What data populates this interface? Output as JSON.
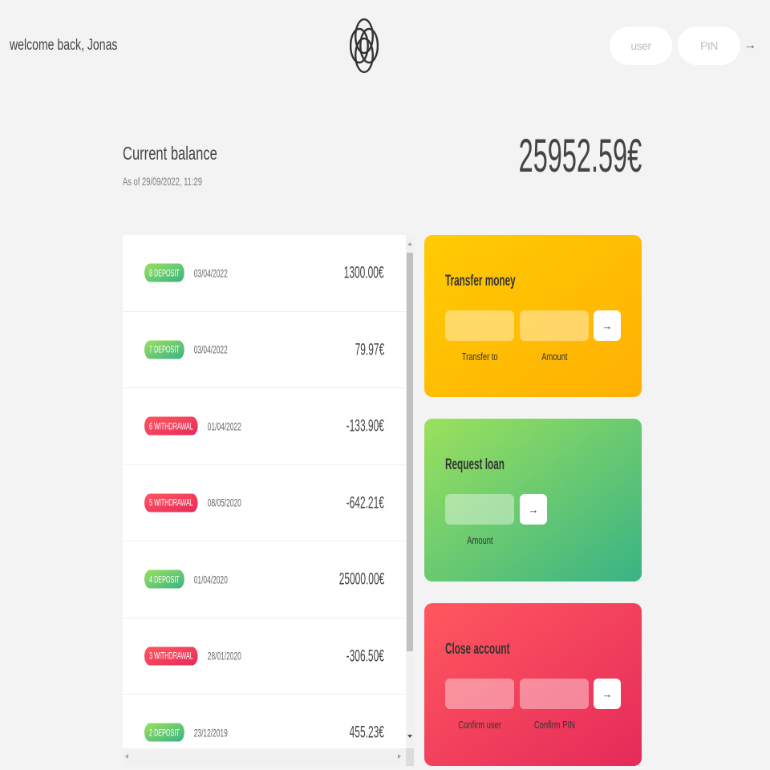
{
  "nav": {
    "welcome": "welcome back, Jonas",
    "login": {
      "user_placeholder": "user",
      "pin_placeholder": "PIN",
      "submit_label": "→"
    }
  },
  "balance": {
    "label": "Current balance",
    "as_of": "As of 29/09/2022, 11:29",
    "value": "25952.59€"
  },
  "movements": [
    {
      "number": "8",
      "type": "DEPOSIT",
      "date": "03/04/2022",
      "value": "1300.00€"
    },
    {
      "number": "7",
      "type": "DEPOSIT",
      "date": "03/04/2022",
      "value": "79.97€"
    },
    {
      "number": "6",
      "type": "WITHDRAWAL",
      "date": "01/04/2022",
      "value": "-133.90€"
    },
    {
      "number": "5",
      "type": "WITHDRAWAL",
      "date": "08/05/2020",
      "value": "-642.21€"
    },
    {
      "number": "4",
      "type": "DEPOSIT",
      "date": "01/04/2020",
      "value": "25000.00€"
    },
    {
      "number": "3",
      "type": "WITHDRAWAL",
      "date": "28/01/2020",
      "value": "-306.50€"
    },
    {
      "number": "2",
      "type": "DEPOSIT",
      "date": "23/12/2019",
      "value": "455.23€"
    }
  ],
  "operations": {
    "transfer": {
      "title": "Transfer money",
      "to_label": "Transfer to",
      "amount_label": "Amount",
      "button_label": "→"
    },
    "loan": {
      "title": "Request loan",
      "amount_label": "Amount",
      "button_label": "→"
    },
    "close": {
      "title": "Close account",
      "user_label": "Confirm user",
      "pin_label": "Confirm PIN",
      "button_label": "→"
    }
  },
  "colors": {
    "page_background": "#f3f3f3",
    "deposit_gradient": [
      "#9be15d",
      "#39b385"
    ],
    "withdrawal_gradient": [
      "#ff585f",
      "#e52a5a"
    ],
    "transfer_gradient": [
      "#ffcb03",
      "#ffb003"
    ],
    "loan_gradient": [
      "#9be15d",
      "#39b385"
    ],
    "close_gradient": [
      "#ff585f",
      "#e52a5a"
    ]
  }
}
